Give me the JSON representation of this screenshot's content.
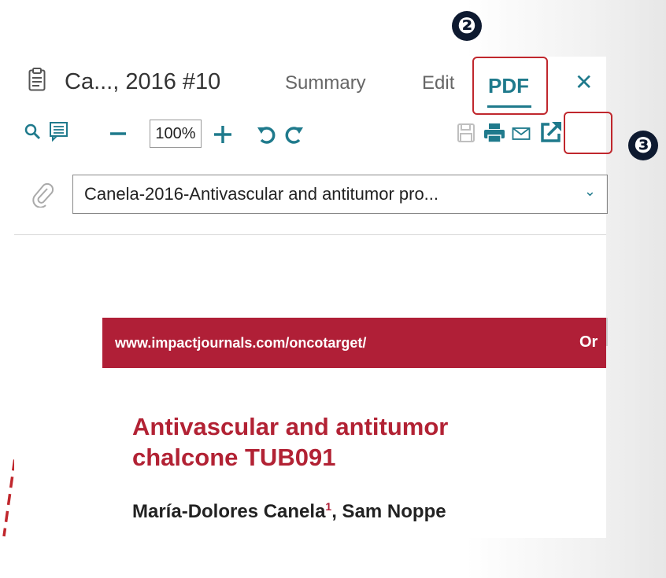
{
  "annotations": {
    "step2": "❷",
    "step3": "❸"
  },
  "header": {
    "doc_title": "Ca..., 2016 #10",
    "tabs": [
      "Summary",
      "Edit",
      "PDF"
    ],
    "close": "✕"
  },
  "toolbar": {
    "zoom_value": "100%"
  },
  "attachment": {
    "selected_file": "Canela-2016-Antivascular and antitumor pro..."
  },
  "pdf": {
    "journal_url": "www.impactjournals.com/oncotarget/",
    "journal_right": "Or",
    "title_line1": "Antivascular and antitumor",
    "title_line2": "chalcone TUB091",
    "author1": "María-Dolores Canela",
    "author1_sup": "1",
    "author2": ", Sam Noppe"
  },
  "colors": {
    "accent": "#1f7a8c",
    "highlight": "#c0272d",
    "journal": "#b01f37",
    "title": "#b22234"
  }
}
